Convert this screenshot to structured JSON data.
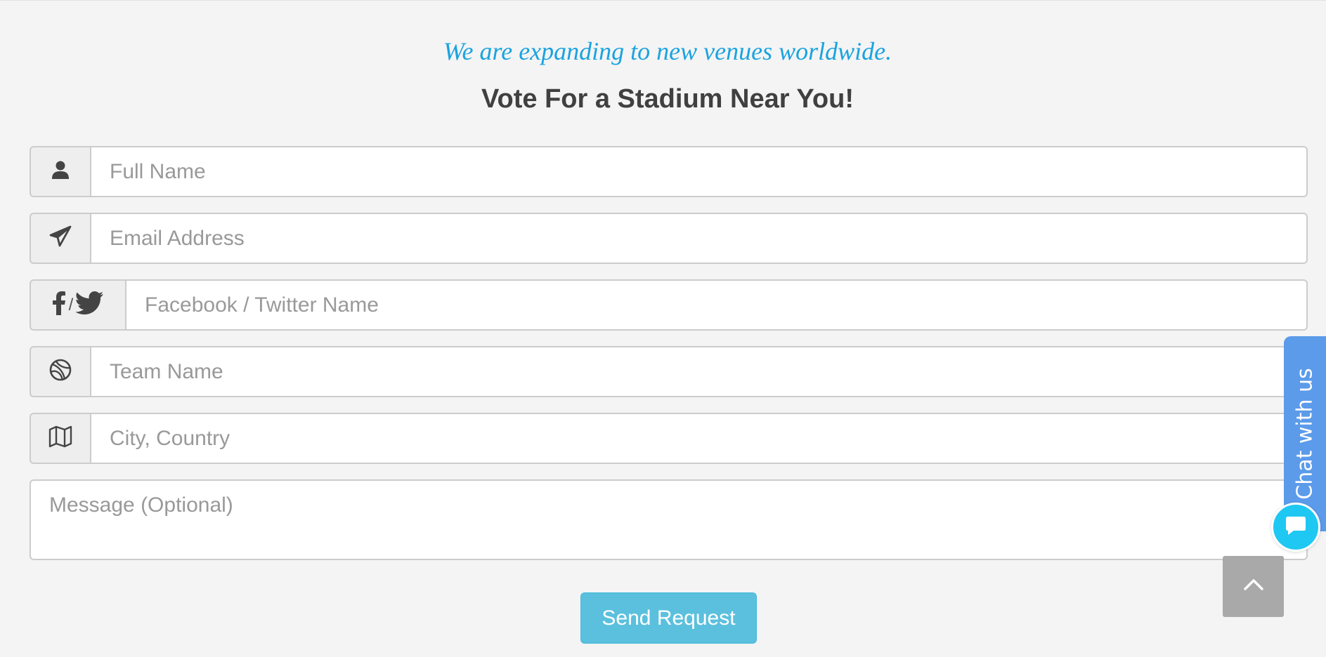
{
  "header": {
    "tagline": "We are expanding to new venues worldwide.",
    "title": "Vote For a Stadium Near You!"
  },
  "form": {
    "full_name": {
      "value": "",
      "placeholder": "Full Name",
      "icon": "user-icon"
    },
    "email": {
      "value": "",
      "placeholder": "Email Address",
      "icon": "paper-plane-icon"
    },
    "social": {
      "value": "",
      "placeholder": "Facebook / Twitter Name",
      "icon_left": "facebook-icon",
      "separator": "/",
      "icon_right": "twitter-icon"
    },
    "team": {
      "value": "",
      "placeholder": "Team Name",
      "icon": "basketball-icon"
    },
    "city": {
      "value": "",
      "placeholder": "City, Country",
      "icon": "map-icon"
    },
    "message": {
      "value": "",
      "placeholder": "Message (Optional)"
    },
    "submit_label": "Send Request"
  },
  "chat_widget": {
    "tab_label": "Chat with us",
    "bubble_icon": "chat-bubble-icon",
    "colors": {
      "tab": "#5b9bea",
      "bubble": "#1ec8f2"
    }
  },
  "scroll_top": {
    "icon": "chevron-up-icon"
  },
  "colors": {
    "tagline": "#1aa3df",
    "button": "#5bc0de",
    "background": "#f4f4f4"
  }
}
